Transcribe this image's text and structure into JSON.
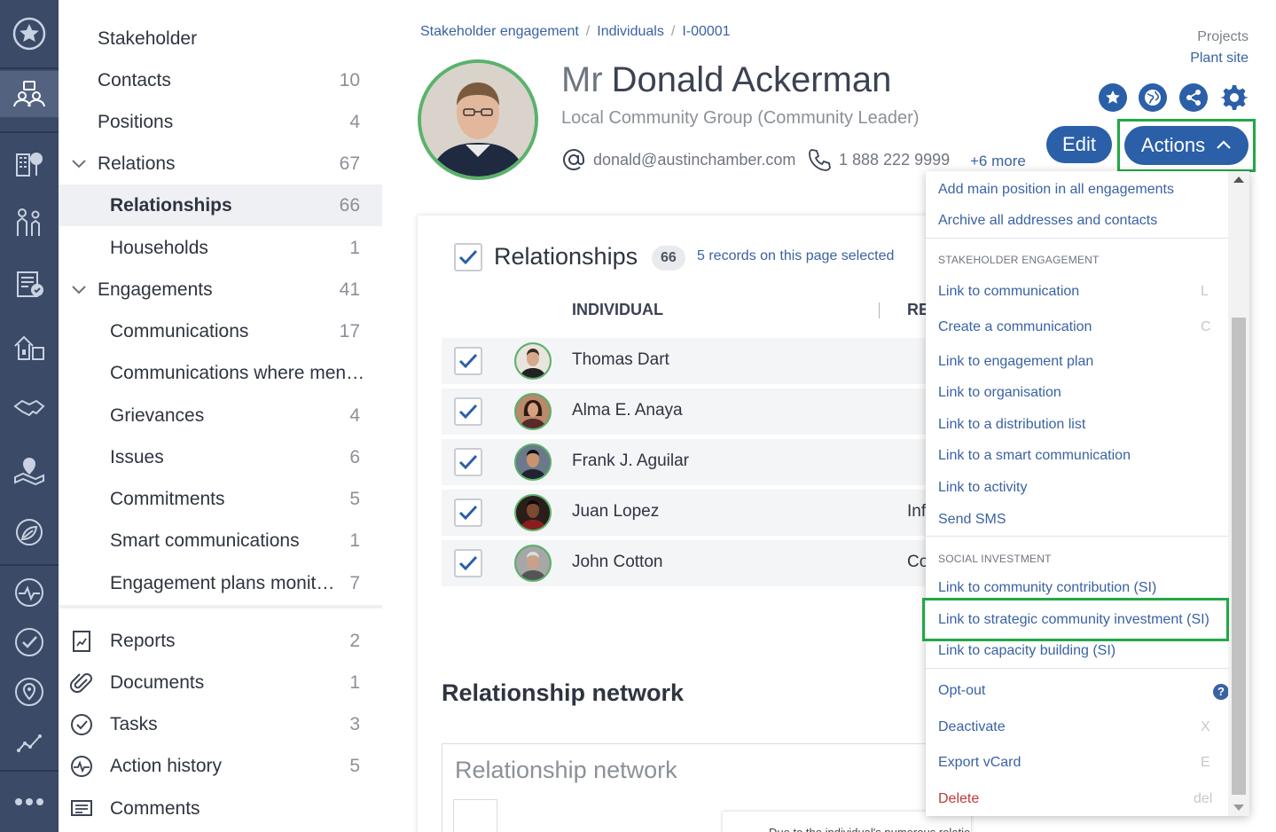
{
  "breadcrumb": [
    "Stakeholder engagement",
    "Individuals",
    "I-00001"
  ],
  "project": {
    "label": "Projects",
    "value": "Plant site"
  },
  "person": {
    "title": "Mr",
    "name": "Donald Ackerman",
    "role": "Local Community Group (Community Leader)",
    "email": "donald@austinchamber.com",
    "phone": "1 888 222 9999",
    "more": "+6 more"
  },
  "buttons": {
    "edit": "Edit",
    "actions": "Actions"
  },
  "sidebar": {
    "items": [
      {
        "label": "Stakeholder",
        "count": ""
      },
      {
        "label": "Contacts",
        "count": "10"
      },
      {
        "label": "Positions",
        "count": "4"
      },
      {
        "label": "Relations",
        "count": "67"
      },
      {
        "label": "Relationships",
        "count": "66"
      },
      {
        "label": "Households",
        "count": "1"
      },
      {
        "label": "Engagements",
        "count": "41"
      },
      {
        "label": "Communications",
        "count": "17"
      },
      {
        "label": "Communications where men…",
        "count": ""
      },
      {
        "label": "Grievances",
        "count": "4"
      },
      {
        "label": "Issues",
        "count": "6"
      },
      {
        "label": "Commitments",
        "count": "5"
      },
      {
        "label": "Smart communications",
        "count": "1"
      },
      {
        "label": "Engagement plans monit…",
        "count": "7"
      }
    ],
    "bottom": [
      {
        "label": "Reports",
        "count": "2"
      },
      {
        "label": "Documents",
        "count": "1"
      },
      {
        "label": "Tasks",
        "count": "3"
      },
      {
        "label": "Action history",
        "count": "5"
      },
      {
        "label": "Comments",
        "count": ""
      }
    ]
  },
  "relationships": {
    "title": "Relationships",
    "count": "66",
    "selected_text": "5 records on this page selected",
    "columns": [
      "INDIVIDUAL",
      "RE"
    ],
    "rows": [
      {
        "name": "Thomas Dart",
        "rel": ""
      },
      {
        "name": "Alma E. Anaya",
        "rel": ""
      },
      {
        "name": "Frank J. Aguilar",
        "rel": ""
      },
      {
        "name": "Juan Lopez",
        "rel": "Inf"
      },
      {
        "name": "John Cotton",
        "rel": "Co"
      }
    ]
  },
  "network": {
    "heading": "Relationship network",
    "box_title": "Relationship network",
    "toggle": "»",
    "note": "Due to the individual's numerous relations, the current chart only"
  },
  "menu": {
    "top_items": [
      "Add main position in all engagements",
      "Archive all addresses and contacts"
    ],
    "section1": "STAKEHOLDER ENGAGEMENT",
    "se_items": [
      {
        "label": "Link to communication",
        "key": "L"
      },
      {
        "label": "Create a communication",
        "key": "C"
      },
      {
        "label": "Link to engagement plan",
        "key": ""
      },
      {
        "label": "Link to organisation",
        "key": ""
      },
      {
        "label": "Link to a distribution list",
        "key": ""
      },
      {
        "label": "Link to a smart communication",
        "key": ""
      },
      {
        "label": "Link to activity",
        "key": ""
      },
      {
        "label": "Send SMS",
        "key": ""
      }
    ],
    "section2": "SOCIAL INVESTMENT",
    "si_items": [
      {
        "label": "Link to community contribution (SI)"
      },
      {
        "label": "Link to strategic community investment (SI)"
      },
      {
        "label": "Link to capacity building (SI)"
      }
    ],
    "bottom_items": [
      {
        "label": "Opt-out",
        "key": "?"
      },
      {
        "label": "Deactivate",
        "key": "X"
      },
      {
        "label": "Export vCard",
        "key": "E"
      },
      {
        "label": "Delete",
        "key": "del"
      }
    ]
  }
}
